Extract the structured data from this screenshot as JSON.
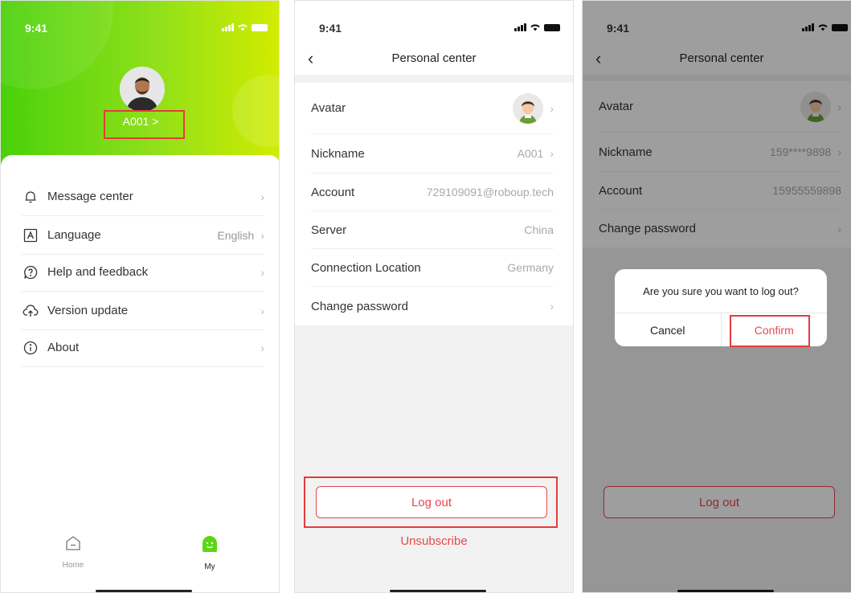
{
  "status": {
    "time": "9:41"
  },
  "my_screen": {
    "user_name": "A001",
    "chevron": ">",
    "menu": [
      {
        "icon": "bell-icon",
        "label": "Message center",
        "value": ""
      },
      {
        "icon": "language-icon",
        "label": "Language",
        "value": "English"
      },
      {
        "icon": "help-icon",
        "label": "Help and feedback",
        "value": ""
      },
      {
        "icon": "cloud-upload-icon",
        "label": "Version update",
        "value": ""
      },
      {
        "icon": "info-icon",
        "label": "About",
        "value": ""
      }
    ],
    "tabs": {
      "home": "Home",
      "my": "My"
    }
  },
  "personal_center": {
    "title": "Personal center",
    "rows": {
      "avatar": "Avatar",
      "nickname_label": "Nickname",
      "nickname_value": "A001",
      "account_label": "Account",
      "account_value": "729109091@roboup.tech",
      "server_label": "Server",
      "server_value": "China",
      "location_label": "Connection Location",
      "location_value": "Germany",
      "password_label": "Change password"
    },
    "logout": "Log out",
    "unsubscribe": "Unsubscribe"
  },
  "confirm_screen": {
    "title": "Personal center",
    "rows": {
      "avatar": "Avatar",
      "nickname_label": "Nickname",
      "nickname_value": "159****9898",
      "account_label": "Account",
      "account_value": "15955559898",
      "password_label": "Change password"
    },
    "dialog": {
      "message": "Are you sure you want to log out?",
      "cancel": "Cancel",
      "confirm": "Confirm"
    },
    "logout": "Log out"
  },
  "colors": {
    "accent_green": "#49d10a",
    "danger_red": "#e5484d",
    "highlight_red": "#e53b3b"
  }
}
